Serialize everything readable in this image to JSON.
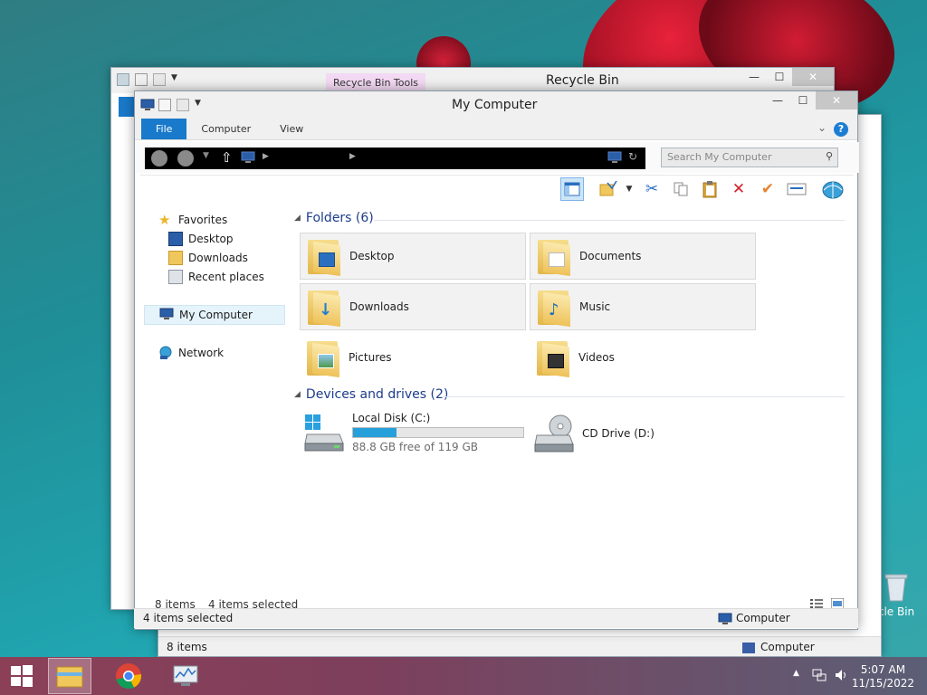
{
  "desktop": {
    "recycle_bin_label": "cle Bin"
  },
  "back_window": {
    "title": "Recycle Bin",
    "tool_tab": "Recycle Bin Tools"
  },
  "third_window": {
    "status_items": "8 items",
    "status_location": "Computer"
  },
  "front_window": {
    "title": "My Computer",
    "ribbon_tabs": [
      "File",
      "Computer",
      "View"
    ],
    "search_placeholder": "Search My Computer",
    "nav": {
      "favorites": "Favorites",
      "desktop": "Desktop",
      "downloads": "Downloads",
      "recent": "Recent places",
      "my_computer": "My Computer",
      "network": "Network"
    },
    "folders_group": "Folders (6)",
    "folders": [
      {
        "label": "Desktop",
        "selected": true,
        "icon": "desktop-folder-icon"
      },
      {
        "label": "Documents",
        "selected": true,
        "icon": "documents-folder-icon"
      },
      {
        "label": "Downloads",
        "selected": true,
        "icon": "downloads-folder-icon"
      },
      {
        "label": "Music",
        "selected": true,
        "icon": "music-folder-icon"
      },
      {
        "label": "Pictures",
        "selected": false,
        "icon": "pictures-folder-icon"
      },
      {
        "label": "Videos",
        "selected": false,
        "icon": "videos-folder-icon"
      }
    ],
    "drives_group": "Devices and drives (2)",
    "drives": {
      "c_label": "Local Disk (C:)",
      "c_free": "88.8 GB free of 119 GB",
      "c_used_fraction": 0.254,
      "d_label": "CD Drive (D:)"
    },
    "status_items": "8 items",
    "status_selected": "4 items selected",
    "outer_status_selected": "4 items selected",
    "outer_status_location": "Computer"
  },
  "taskbar": {
    "time": "5:07 AM",
    "date": "11/15/2022"
  },
  "colors": {
    "accent": "#1979ca",
    "progress": "#26a0da",
    "group_heading": "#1c3d8c"
  }
}
